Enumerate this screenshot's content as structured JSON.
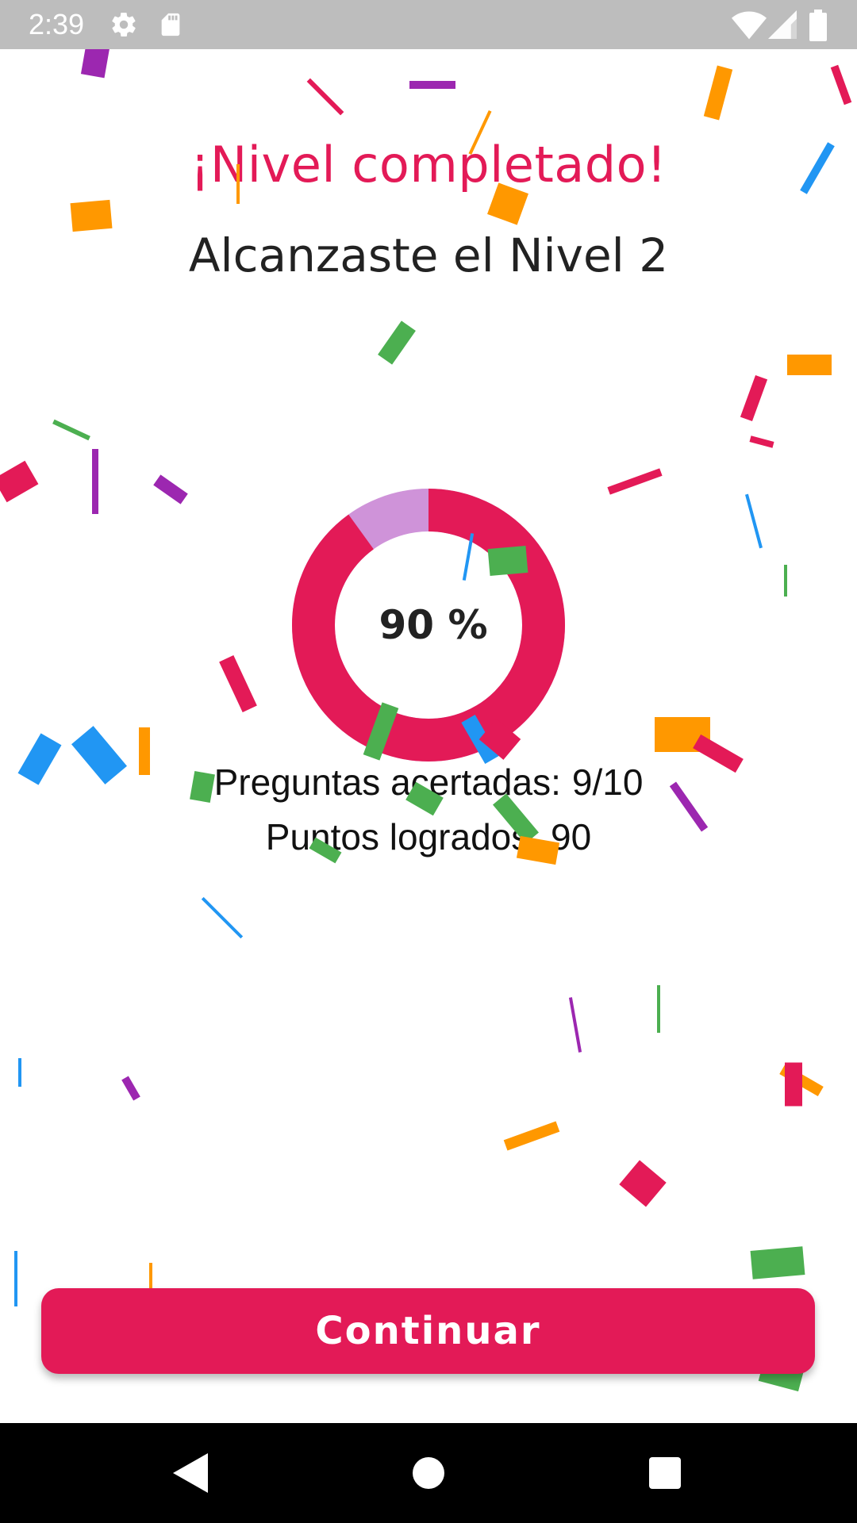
{
  "status_bar": {
    "time": "2:39",
    "icons": [
      "gear-icon",
      "sd-card-icon",
      "wifi-icon",
      "signal-icon",
      "battery-icon"
    ]
  },
  "header": {
    "title": "¡Nivel completado!",
    "subtitle": "Alcanzaste el Nivel 2"
  },
  "progress": {
    "label": "90 %",
    "fraction": 0.9,
    "colors": {
      "filled": "#e31a57",
      "remaining": "#cf93d9"
    }
  },
  "stats": {
    "correct_label": "Preguntas acertadas:",
    "correct_value": "9/10",
    "points_label": "Puntos logrados:",
    "points_value": "90"
  },
  "actions": {
    "continue_label": "Continuar"
  },
  "colors": {
    "accent": "#e31a57",
    "confetti": [
      "#e31a57",
      "#9c27b0",
      "#ff9800",
      "#4caf50",
      "#2196f3"
    ]
  },
  "nav_bar": {
    "icons": [
      "back-icon",
      "home-icon",
      "recents-icon"
    ]
  }
}
